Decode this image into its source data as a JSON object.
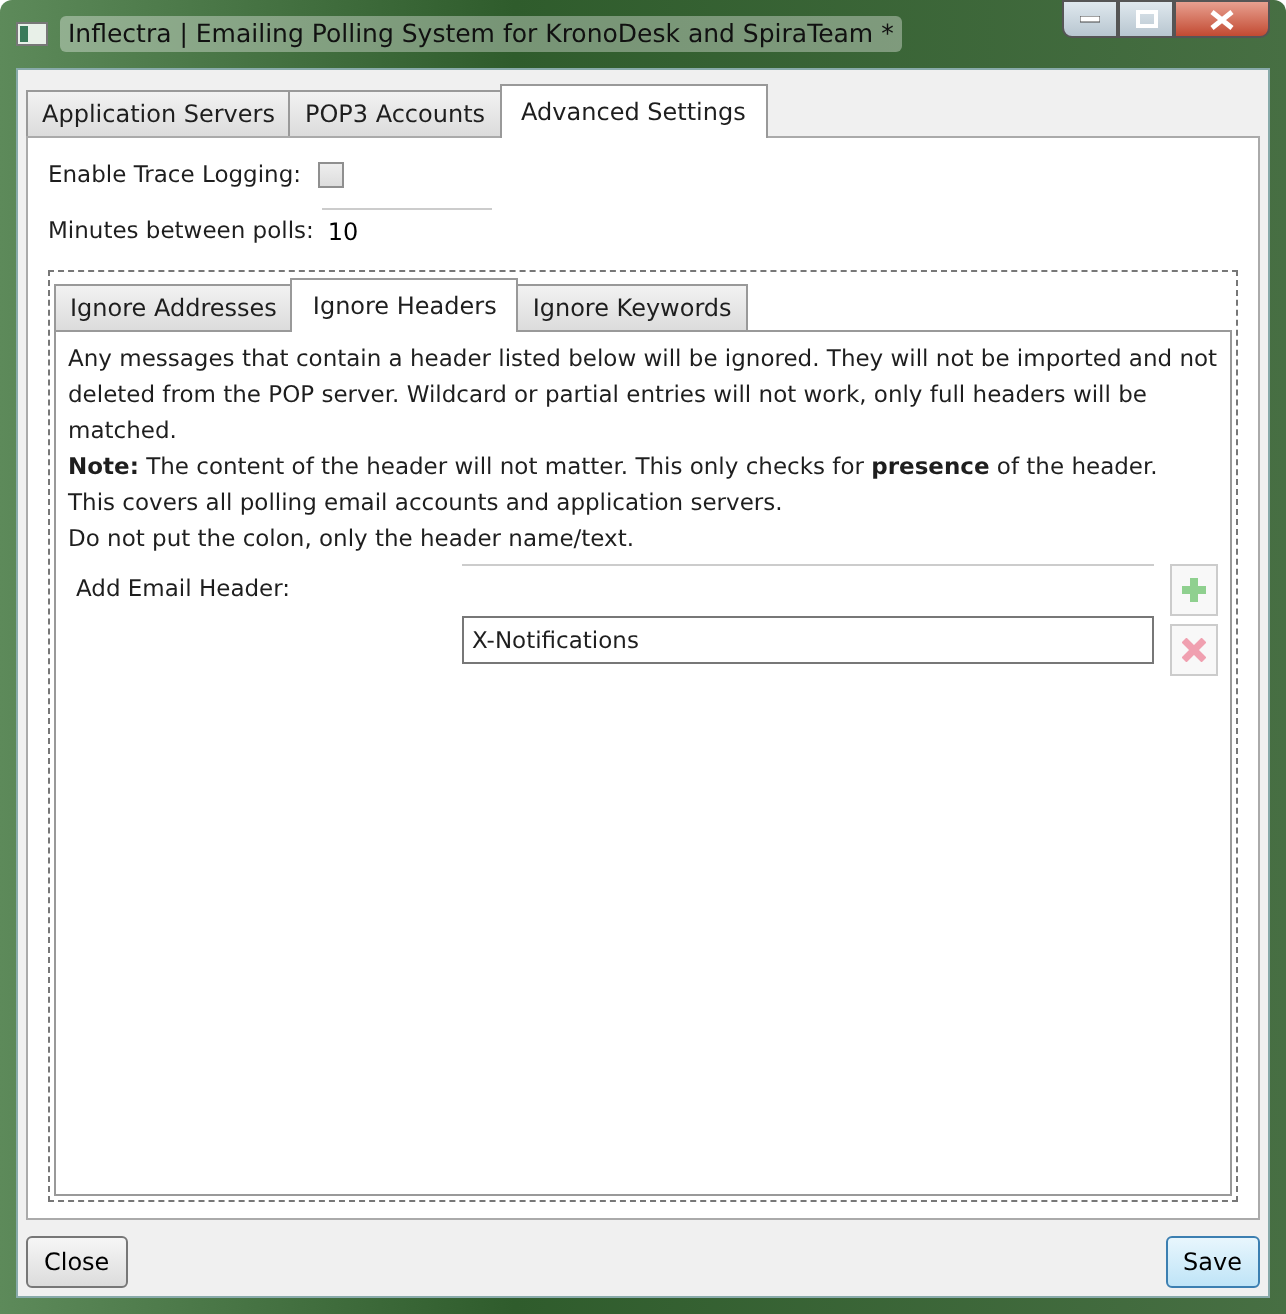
{
  "window": {
    "title": "Inflectra | Emailing Polling System for KronoDesk and SpiraTeam *"
  },
  "tabs": [
    {
      "label": "Application Servers",
      "selected": false
    },
    {
      "label": "POP3 Accounts",
      "selected": false
    },
    {
      "label": "Advanced Settings",
      "selected": true
    }
  ],
  "trace_logging": {
    "label": "Enable Trace Logging:",
    "checked": false
  },
  "poll_minutes": {
    "label": "Minutes between polls:",
    "value": "10"
  },
  "subtabs": [
    {
      "label": "Ignore Addresses",
      "selected": false
    },
    {
      "label": "Ignore Headers",
      "selected": true
    },
    {
      "label": "Ignore Keywords",
      "selected": false
    }
  ],
  "description": [
    "Any messages that contain a header listed below will be ignored. They will not be imported and not deleted from the POP server. Wildcard or partial entries will not work, only full headers will be matched.",
    "**Note:** The content of the header will not matter. This only checks for **presence** of the header.",
    "This covers all polling email accounts and application servers.",
    "Do not put the colon, only the header name/text."
  ],
  "add_header": {
    "label": "Add Email Header:"
  },
  "headers": [
    {
      "text": "X-Notifications"
    }
  ],
  "buttons": [
    {
      "label": "Close",
      "kind": "normal"
    },
    {
      "label": "Save",
      "kind": "default"
    }
  ]
}
